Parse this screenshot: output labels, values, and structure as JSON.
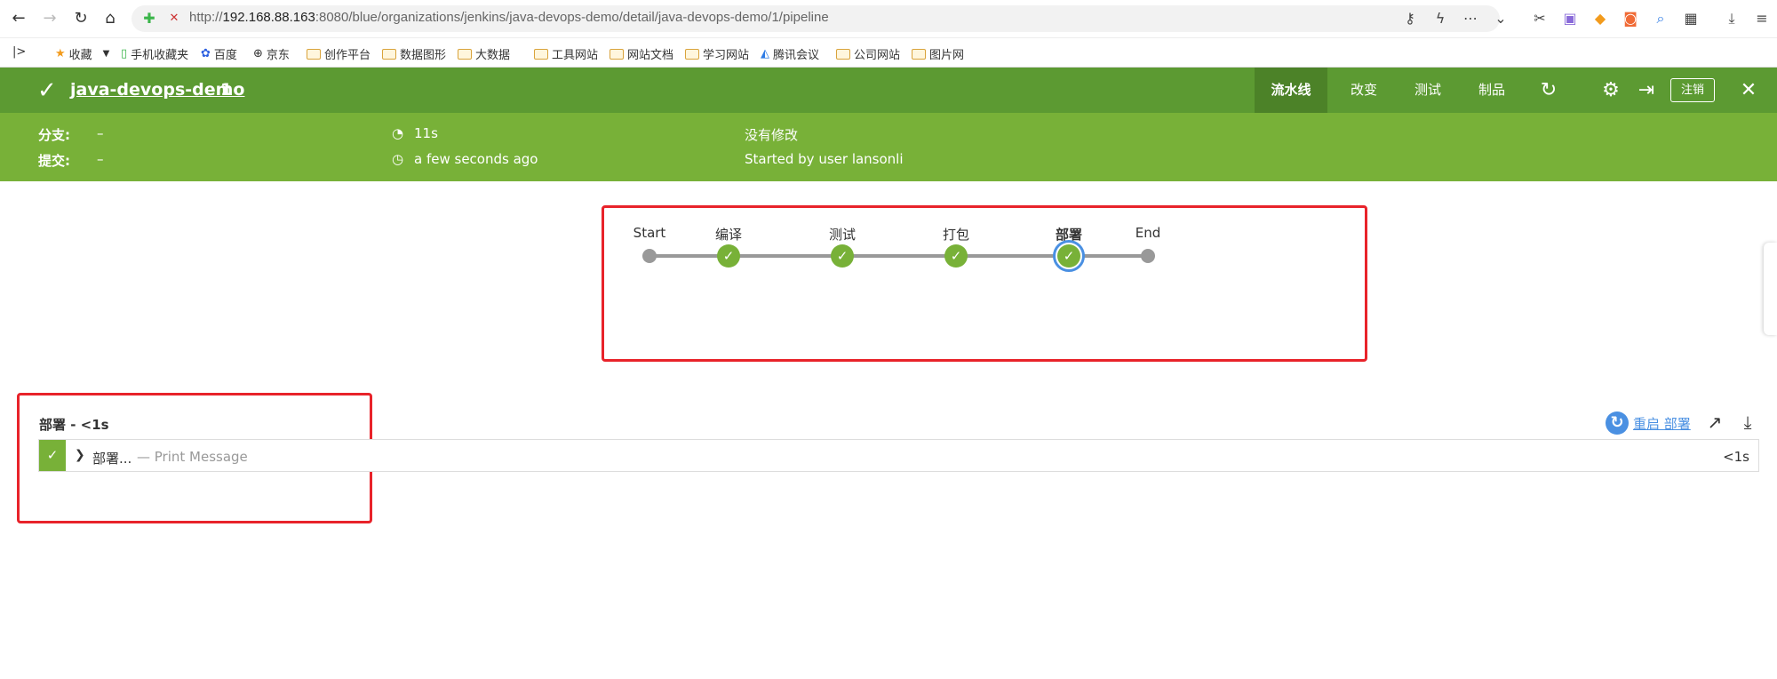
{
  "browser": {
    "url_prefix": "http://",
    "url_host": "192.168.88.163",
    "url_rest": ":8080/blue/organizations/jenkins/java-devops-demo/detail/java-devops-demo/1/pipeline",
    "icons": [
      "back-icon",
      "forward-icon",
      "refresh-icon",
      "home-icon",
      "shield-icon",
      "key-icon",
      "bolt-icon",
      "more-icon",
      "chevron-down-icon",
      "scissors-icon",
      "translate-icon",
      "coupon-icon",
      "game-icon",
      "search-icon",
      "apps-icon",
      "download-icon",
      "menu-icon"
    ]
  },
  "bookmarks": [
    {
      "label": "收藏",
      "icon": "star-icon"
    },
    {
      "label": "手机收藏夹",
      "icon": "phone-icon"
    },
    {
      "label": "百度",
      "icon": "baidu-icon"
    },
    {
      "label": "京东",
      "icon": "globe-icon"
    },
    {
      "label": "创作平台",
      "icon": "folder-icon"
    },
    {
      "label": "数据图形",
      "icon": "folder-icon"
    },
    {
      "label": "大数据",
      "icon": "folder-icon"
    },
    {
      "label": "工具网站",
      "icon": "folder-icon"
    },
    {
      "label": "网站文档",
      "icon": "folder-icon"
    },
    {
      "label": "学习网站",
      "icon": "folder-icon"
    },
    {
      "label": "腾讯会议",
      "icon": "meeting-icon"
    },
    {
      "label": "公司网站",
      "icon": "folder-icon"
    },
    {
      "label": "图片网",
      "icon": "folder-icon"
    }
  ],
  "header": {
    "title": "java-devops-demo",
    "run_number": "1",
    "tabs": [
      "流水线",
      "改变",
      "测试",
      "制品"
    ],
    "logout": "注销",
    "colors": {
      "header": "#5c9a32",
      "details": "#78b138",
      "success": "#78b138",
      "selected": "#4a90e2"
    }
  },
  "details": {
    "branch_label": "分支:",
    "branch_value": "–",
    "commit_label": "提交:",
    "commit_value": "–",
    "duration": "11s",
    "time_ago": "a few seconds ago",
    "changes": "没有修改",
    "started_by": "Started by user lansonli"
  },
  "pipeline": {
    "stages": [
      {
        "label": "Start",
        "status": "endpoint"
      },
      {
        "label": "编译",
        "status": "success"
      },
      {
        "label": "测试",
        "status": "success"
      },
      {
        "label": "打包",
        "status": "success"
      },
      {
        "label": "部署",
        "status": "success",
        "selected": true
      },
      {
        "label": "End",
        "status": "endpoint"
      }
    ]
  },
  "steps": {
    "title": "部署 - <1s",
    "restart": "重启 部署",
    "rows": [
      {
        "name": "部署...",
        "message": "— Print Message",
        "duration": "<1s",
        "status": "success"
      }
    ]
  }
}
